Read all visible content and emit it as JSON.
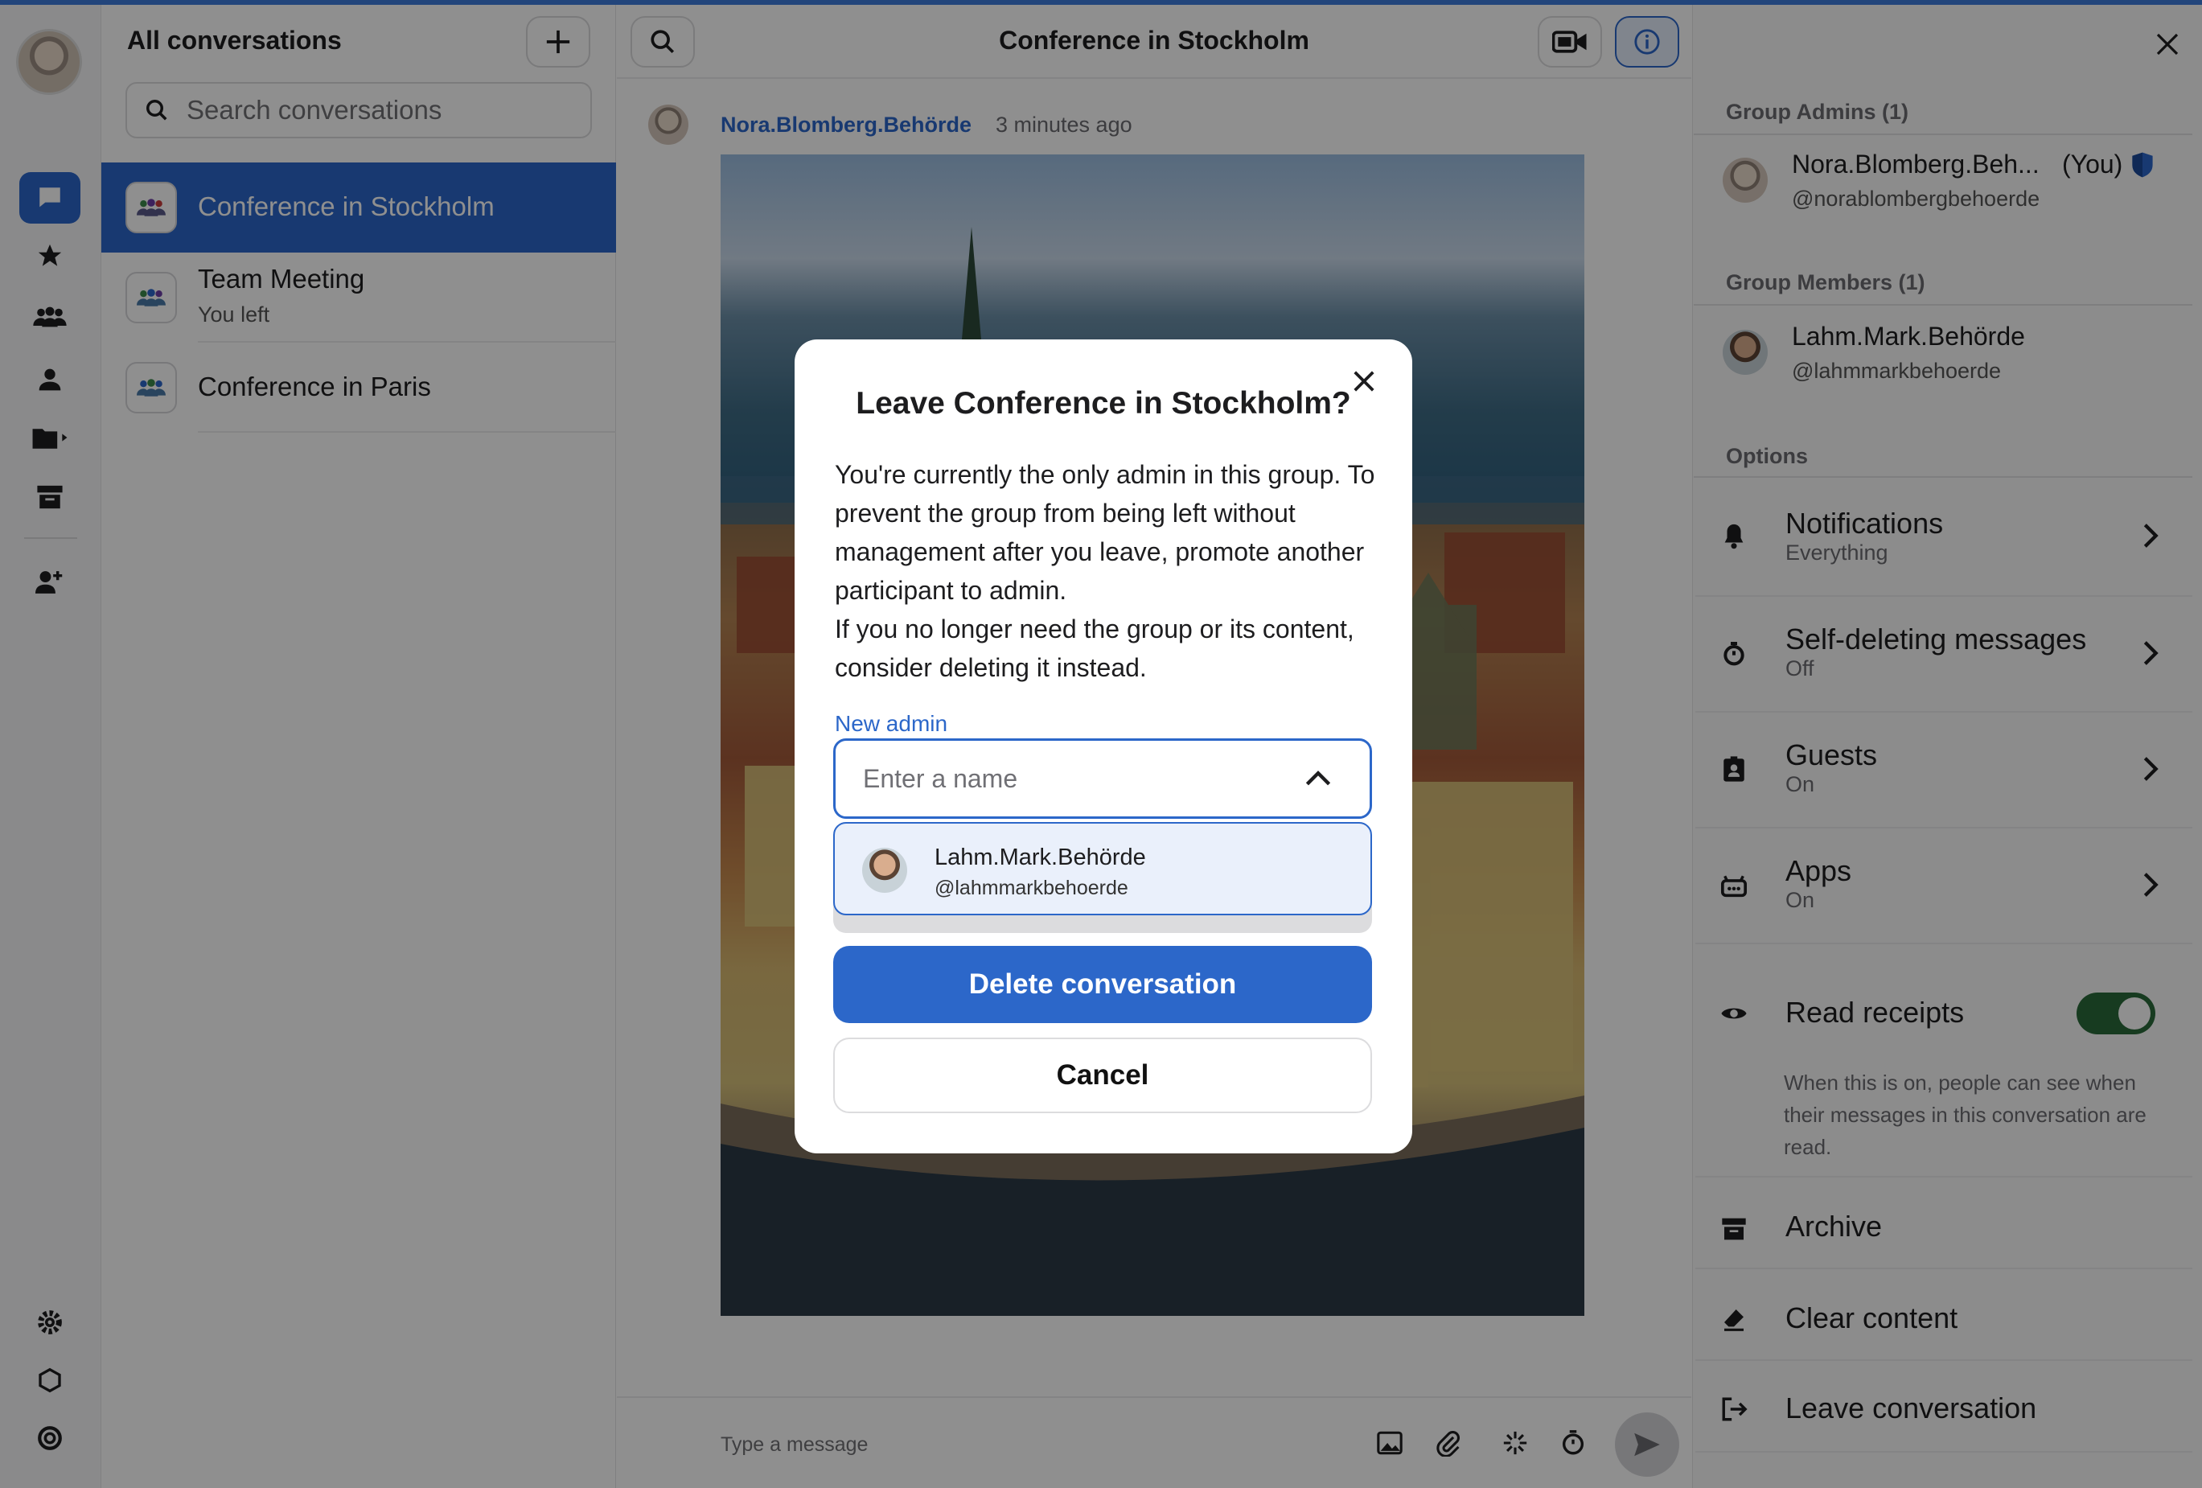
{
  "rail": {
    "items": [
      "chats-icon",
      "favorites-icon",
      "groups-icon",
      "people-icon",
      "folders-icon",
      "archive-icon",
      "add-contact-icon",
      "settings-icon",
      "shield-icon",
      "support-icon"
    ]
  },
  "list": {
    "title": "All conversations",
    "search_placeholder": "Search conversations",
    "conversations": [
      {
        "name": "Conference in Stockholm",
        "sub": ""
      },
      {
        "name": "Team Meeting",
        "sub": "You left"
      },
      {
        "name": "Conference in Paris",
        "sub": ""
      }
    ]
  },
  "header": {
    "title": "Conference in Stockholm"
  },
  "message": {
    "author": "Nora.Blomberg.Behörde",
    "time": "3 minutes ago"
  },
  "composer": {
    "placeholder": "Type a message"
  },
  "details": {
    "admins_heading": "Group Admins (1)",
    "admin": {
      "name": "Nora.Blomberg.Beh...",
      "you": "(You)",
      "handle": "@norablombergbehoerde"
    },
    "members_heading": "Group Members (1)",
    "member": {
      "name": "Lahm.Mark.Behörde",
      "handle": "@lahmmarkbehoerde"
    },
    "options_heading": "Options",
    "options": [
      {
        "title": "Notifications",
        "sub": "Everything"
      },
      {
        "title": "Self-deleting messages",
        "sub": "Off"
      },
      {
        "title": "Guests",
        "sub": "On"
      },
      {
        "title": "Apps",
        "sub": "On"
      }
    ],
    "read_receipts": {
      "title": "Read receipts",
      "enabled": true,
      "desc": "When this is on, people can see when their messages in this conversation are read."
    },
    "archive": "Archive",
    "clear": "Clear content",
    "leave": "Leave conversation"
  },
  "modal": {
    "title": "Leave Conference in Stockholm?",
    "body_1": "You're currently the only admin in this group. To prevent the group from being left without management after you leave, promote another participant to admin.",
    "body_2": "If you no longer need the group or its content, consider deleting it instead.",
    "label": "New admin",
    "input_placeholder": "Enter a name",
    "option": {
      "name": "Lahm.Mark.Behörde",
      "handle": "@lahmmarkbehoerde"
    },
    "delete_label": "Delete conversation",
    "cancel_label": "Cancel"
  },
  "colors": {
    "accent": "#2c67c9",
    "toggle_on": "#2a6a3a"
  }
}
